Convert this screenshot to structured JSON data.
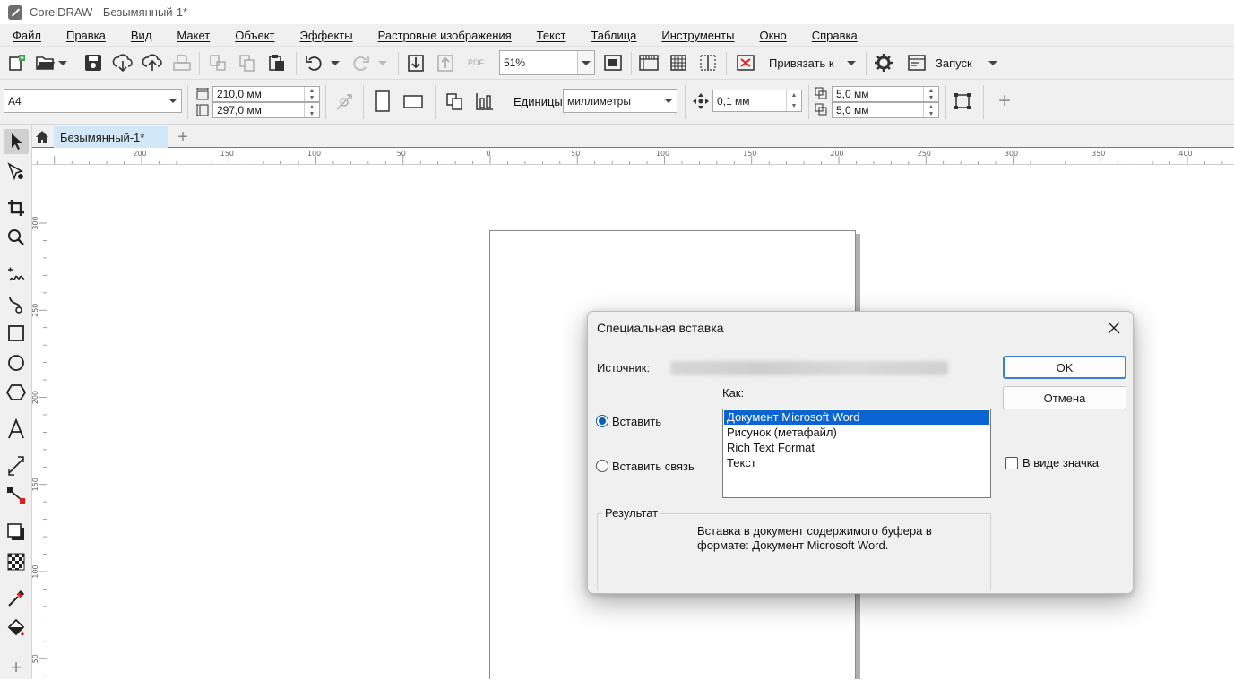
{
  "app": {
    "title": "CorelDRAW - Безымянный-1*"
  },
  "menu": {
    "items": [
      "Файл",
      "Правка",
      "Вид",
      "Макет",
      "Объект",
      "Эффекты",
      "Растровые изображения",
      "Текст",
      "Таблица",
      "Инструменты",
      "Окно",
      "Справка"
    ]
  },
  "toolbar1": {
    "zoom": "51%",
    "snap_label": "Привязать к",
    "launch_label": "Запуск",
    "pdf_label": "PDF"
  },
  "toolbar2": {
    "page_size": "A4",
    "width": "210,0 мм",
    "height": "297,0 мм",
    "units_label": "Единицы:",
    "units_value": "миллиметры",
    "nudge": "0,1 мм",
    "dup_x": "5,0 мм",
    "dup_y": "5,0 мм"
  },
  "tabs": {
    "doc": "Безымянный-1*"
  },
  "ruler": {
    "h_ticks": [
      "200",
      "150",
      "100",
      "50",
      "0",
      "50",
      "100",
      "150",
      "200",
      "250",
      "300",
      "350",
      "400"
    ],
    "v_ticks": [
      "300",
      "250",
      "200",
      "150",
      "100",
      "50"
    ]
  },
  "dialog": {
    "title": "Специальная вставка",
    "source_label": "Источник:",
    "as_label": "Как:",
    "radio_paste": "Вставить",
    "radio_link": "Вставить связь",
    "formats": [
      "Документ Microsoft Word",
      "Рисунок (метафайл)",
      "Rich Text Format",
      "Текст"
    ],
    "selected_format": 0,
    "ok": "OK",
    "cancel": "Отмена",
    "as_icon": "В виде значка",
    "result_label": "Результат",
    "result_text_1": "Вставка в документ содержимого буфера в",
    "result_text_2": "формате: Документ Microsoft Word."
  }
}
